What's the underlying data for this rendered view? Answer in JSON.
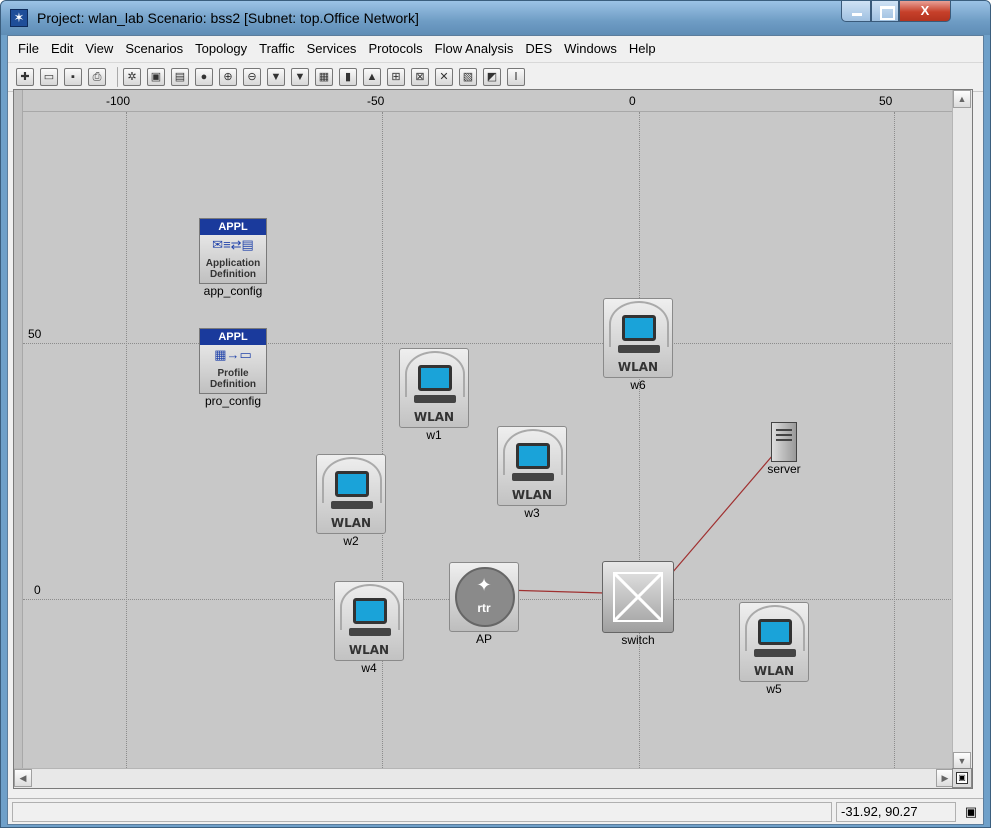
{
  "window": {
    "title": "Project: wlan_lab Scenario: bss2  [Subnet: top.Office Network]",
    "app_icon": "star-icon"
  },
  "menu": [
    "File",
    "Edit",
    "View",
    "Scenarios",
    "Topology",
    "Traffic",
    "Services",
    "Protocols",
    "Flow Analysis",
    "DES",
    "Windows",
    "Help"
  ],
  "toolbar": {
    "icons": [
      "new-project-icon",
      "open-icon",
      "save-icon",
      "print-icon",
      "rapid-config-icon",
      "object-palette-icon",
      "check-consistency-icon",
      "failure-icon",
      "zoom-in-icon",
      "zoom-out-icon",
      "ace-import-icon",
      "vne-import-icon",
      "configure-traffic-icon",
      "run-simulation-icon",
      "view-results-icon",
      "hide-graphs-icon",
      "discrete-event-icon",
      "link-icon",
      "web-report-icon",
      "graph-icon",
      "marker-icon"
    ]
  },
  "ruler": {
    "x_ticks": [
      "-100",
      "-50",
      "0",
      "50"
    ],
    "y_ticks": [
      "50",
      "0"
    ]
  },
  "nodes": {
    "app_config": {
      "label": "app_config",
      "head": "APPL",
      "sub": "Application Definition"
    },
    "pro_config": {
      "label": "pro_config",
      "head": "APPL",
      "sub": "Profile Definition"
    },
    "w1": {
      "label": "w1",
      "tag": "WLAN"
    },
    "w2": {
      "label": "w2",
      "tag": "WLAN"
    },
    "w3": {
      "label": "w3",
      "tag": "WLAN"
    },
    "w4": {
      "label": "w4",
      "tag": "WLAN"
    },
    "w5": {
      "label": "w5",
      "tag": "WLAN"
    },
    "w6": {
      "label": "w6",
      "tag": "WLAN"
    },
    "ap": {
      "label": "AP",
      "tag": "rtr"
    },
    "switch": {
      "label": "switch"
    },
    "server": {
      "label": "server"
    }
  },
  "status": {
    "coords": "-31.92, 90.27"
  },
  "colors": {
    "link": "#a03030",
    "workspace": "#c8c8c8",
    "appl_header": "#1a3a9c",
    "screen": "#1aa3d9"
  }
}
